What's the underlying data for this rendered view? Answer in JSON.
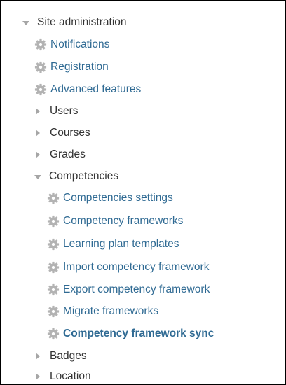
{
  "tree": {
    "root": {
      "label": "Site administration",
      "expanded": true
    },
    "items": [
      {
        "label": "Notifications",
        "icon": "gear-icon"
      },
      {
        "label": "Registration",
        "icon": "gear-icon"
      },
      {
        "label": "Advanced features",
        "icon": "gear-icon"
      }
    ],
    "collapsed_top": [
      {
        "label": "Users"
      },
      {
        "label": "Courses"
      },
      {
        "label": "Grades"
      }
    ],
    "competencies": {
      "label": "Competencies",
      "expanded": true,
      "children": [
        {
          "label": "Competencies settings",
          "icon": "gear-icon"
        },
        {
          "label": "Competency frameworks",
          "icon": "gear-icon"
        },
        {
          "label": "Learning plan templates",
          "icon": "gear-icon"
        },
        {
          "label": "Import competency framework",
          "icon": "gear-icon"
        },
        {
          "label": "Export competency framework",
          "icon": "gear-icon"
        },
        {
          "label": "Migrate frameworks",
          "icon": "gear-icon"
        },
        {
          "label": "Competency framework sync",
          "icon": "gear-icon",
          "active": true
        }
      ]
    },
    "collapsed_bottom": [
      {
        "label": "Badges"
      },
      {
        "label": "Location"
      }
    ]
  },
  "colors": {
    "link": "#2f6a93",
    "text": "#333333",
    "triangle": "#a6a6a6",
    "gear": "#b3b3b3",
    "border": "#000000"
  }
}
